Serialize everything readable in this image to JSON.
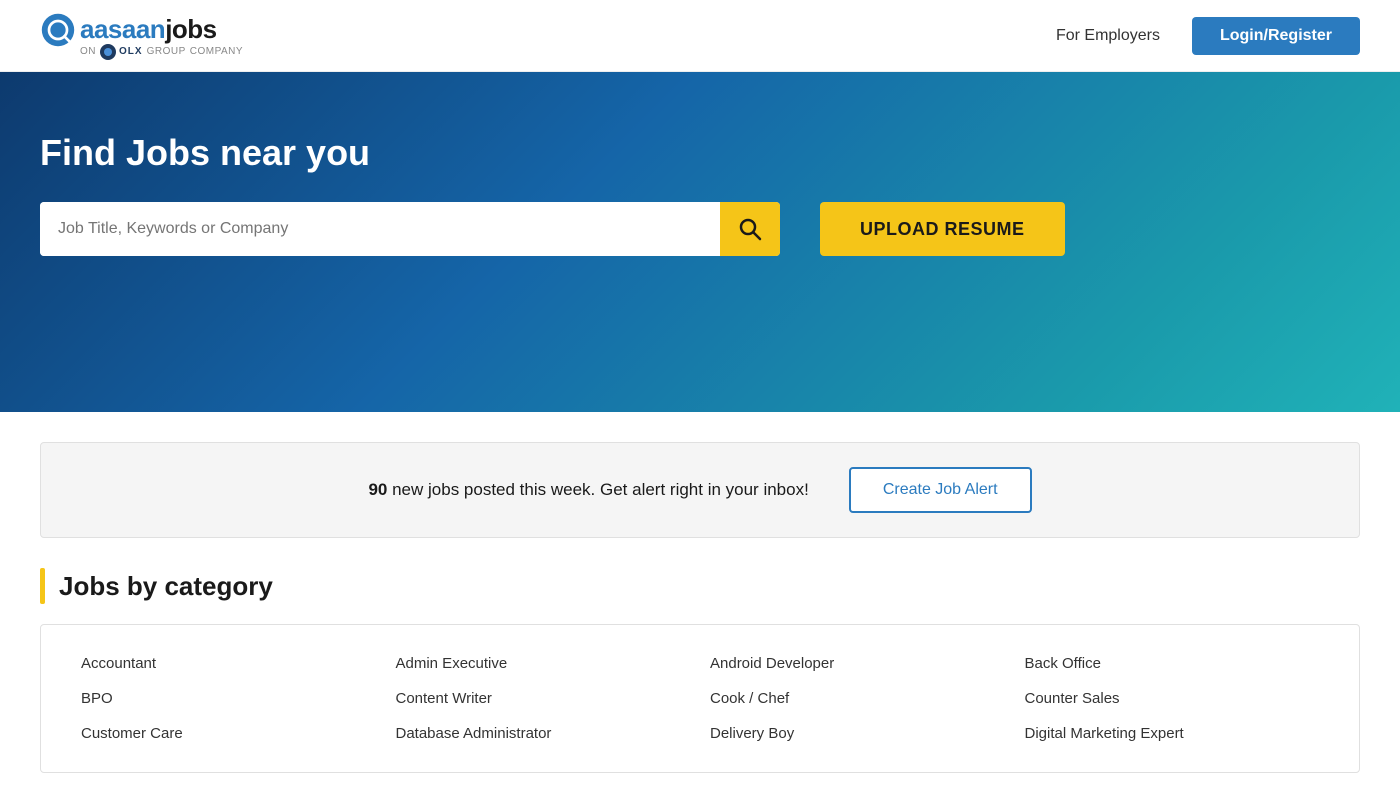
{
  "header": {
    "logo_text_light": "aasaan",
    "logo_text_dark": "jobs",
    "logo_sub_on": "on",
    "logo_sub_olx": "OLX",
    "logo_sub_group": "GROUP",
    "logo_sub_company": "COMPANY",
    "for_employers_label": "For Employers",
    "login_register_label": "Login/Register"
  },
  "hero": {
    "title": "Find Jobs near you",
    "search_placeholder": "Job Title, Keywords or Company",
    "upload_resume_label": "UPLOAD RESUME"
  },
  "alert_banner": {
    "jobs_count": "90",
    "alert_text": "new jobs posted this week. Get alert right in your inbox!",
    "create_alert_label": "Create Job Alert"
  },
  "category_section": {
    "title": "Jobs by category",
    "categories": [
      {
        "label": "Accountant"
      },
      {
        "label": "Admin Executive"
      },
      {
        "label": "Android Developer"
      },
      {
        "label": "Back Office"
      },
      {
        "label": "BPO"
      },
      {
        "label": "Content Writer"
      },
      {
        "label": "Cook / Chef"
      },
      {
        "label": "Counter Sales"
      },
      {
        "label": "Customer Care"
      },
      {
        "label": "Database Administrator"
      },
      {
        "label": "Delivery Boy"
      },
      {
        "label": "Digital Marketing Expert"
      }
    ]
  },
  "colors": {
    "accent_yellow": "#f5c518",
    "brand_blue": "#2b7bbf",
    "hero_dark": "#0d3a6e",
    "hero_teal": "#20b2b8"
  },
  "icons": {
    "search": "🔍",
    "olx_circle": "●"
  }
}
